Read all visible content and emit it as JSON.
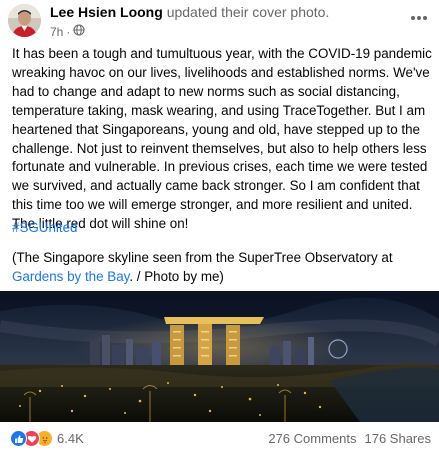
{
  "post": {
    "author": "Lee Hsien Loong",
    "action": "updated their cover photo.",
    "time": "7h",
    "body": "It has been a tough and tumultuous year, with the COVID-19 pandemic wreaking havoc on our lives, livelihoods and established norms. We've had to change and adapt to new norms such as social distancing, temperature taking, mask wearing, and using TraceTogether. But I am heartened that Singaporeans, young and old, have stepped up to the challenge. Not just to reinvent themselves, but also to help others less fortunate and vulnerable. In previous crises, each time we were tested we survived, and actually came back stronger. So I am confident that this time too we will emerge stronger, and more resilient and united. The little red dot will shine on!",
    "hashtag": "#SGUnited",
    "caption_before": "(The Singapore skyline seen from the SuperTree Observatory at",
    "caption_link": "Gardens by the Bay",
    "caption_after": ". / Photo by me)",
    "privacy_icon": "globe-icon",
    "more_icon": "more-horizontal-icon"
  },
  "footer": {
    "reaction_icons": [
      "like-icon",
      "love-icon",
      "care-icon"
    ],
    "reaction_count": "6.4K",
    "comments": "276 Comments",
    "shares": "176 Shares"
  },
  "colors": {
    "link": "#1877f2",
    "secondary_text": "#65676b",
    "like": "#1877f2",
    "love": "#f33e58",
    "care": "#f7b125"
  }
}
